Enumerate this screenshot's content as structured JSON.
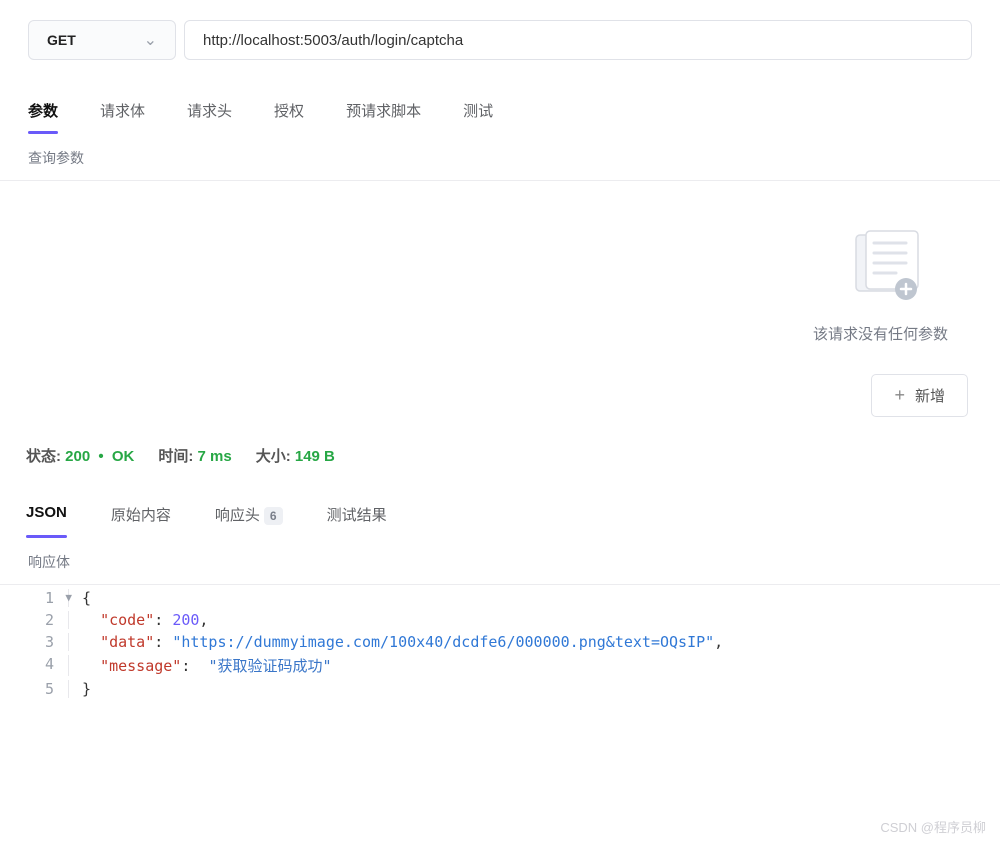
{
  "request": {
    "method": "GET",
    "url": "http://localhost:5003/auth/login/captcha"
  },
  "tabs": [
    {
      "label": "参数",
      "active": true
    },
    {
      "label": "请求体",
      "active": false
    },
    {
      "label": "请求头",
      "active": false
    },
    {
      "label": "授权",
      "active": false
    },
    {
      "label": "预请求脚本",
      "active": false
    },
    {
      "label": "测试",
      "active": false
    }
  ],
  "query_section_label": "查询参数",
  "empty": {
    "text": "该请求没有任何参数",
    "add_label": "新增"
  },
  "status": {
    "state_label": "状态:",
    "code": "200",
    "status_text": "OK",
    "time_label": "时间:",
    "time_value": "7 ms",
    "size_label": "大小:",
    "size_value": "149 B"
  },
  "response_tabs": [
    {
      "label": "JSON",
      "active": true,
      "badge": null
    },
    {
      "label": "原始内容",
      "active": false,
      "badge": null
    },
    {
      "label": "响应头",
      "active": false,
      "badge": "6"
    },
    {
      "label": "测试结果",
      "active": false,
      "badge": null
    }
  ],
  "response_body_label": "响应体",
  "response_json": {
    "code": 200,
    "data": "https://dummyimage.com/100x40/dcdfe6/000000.png&text=OQsIP",
    "message": "获取验证码成功"
  },
  "code_lines": {
    "l1": "{",
    "l2_key": "\"code\"",
    "l2_colon": ": ",
    "l2_val": "200",
    "l2_end": ",",
    "l3_key": "\"data\"",
    "l3_colon": ": ",
    "l3_val": "\"https://dummyimage.com/100x40/dcdfe6/000000.png&text=OQsIP\"",
    "l3_end": ",",
    "l4_key": "\"message\"",
    "l4_colon": ": ",
    "l4_val": "\"获取验证码成功\"",
    "l5": "}"
  },
  "watermark": "CSDN @程序员柳"
}
